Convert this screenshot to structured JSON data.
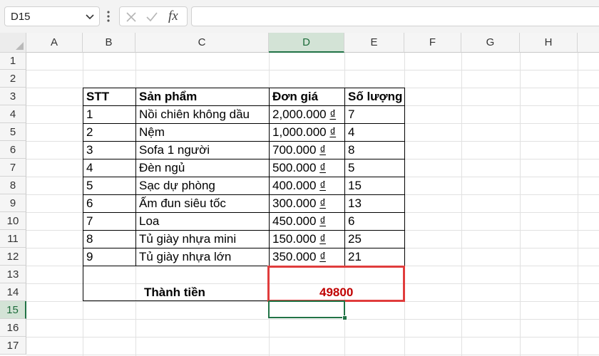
{
  "formula_bar": {
    "name_box": "D15",
    "fx_label": "fx",
    "formula": ""
  },
  "columns": [
    "A",
    "B",
    "C",
    "D",
    "E",
    "F",
    "G",
    "H"
  ],
  "rows": [
    "1",
    "2",
    "3",
    "4",
    "5",
    "6",
    "7",
    "8",
    "9",
    "10",
    "11",
    "12",
    "13",
    "14",
    "15",
    "16",
    "17"
  ],
  "active": {
    "column": "D",
    "row": "15"
  },
  "table": {
    "headers": [
      "STT",
      "Sản phẩm",
      "Đơn giá",
      "Số lượng"
    ],
    "rows": [
      {
        "stt": "1",
        "product": "Nồi chiên không dầu",
        "price": "2,000.000",
        "qty": "7"
      },
      {
        "stt": "2",
        "product": "Nệm",
        "price": "1,000.000",
        "qty": "4"
      },
      {
        "stt": "3",
        "product": "Sofa 1 người",
        "price": "700.000",
        "qty": "8"
      },
      {
        "stt": "4",
        "product": "Đèn ngủ",
        "price": "500.000",
        "qty": "5"
      },
      {
        "stt": "5",
        "product": "Sạc dự phòng",
        "price": "400.000",
        "qty": "15"
      },
      {
        "stt": "6",
        "product": "Ấm đun siêu tốc",
        "price": "300.000",
        "qty": "13"
      },
      {
        "stt": "7",
        "product": "Loa",
        "price": "450.000",
        "qty": "6"
      },
      {
        "stt": "8",
        "product": "Tủ giày nhựa mini",
        "price": "150.000",
        "qty": "25"
      },
      {
        "stt": "9",
        "product": "Tủ giày nhựa lớn",
        "price": "350.000",
        "qty": "21"
      }
    ],
    "currency": "₫",
    "total_label": "Thành tiền",
    "total_value": "49800"
  },
  "colors": {
    "accent": "#217346",
    "highlight_border": "#e03c3c",
    "total_text": "#c00000"
  }
}
